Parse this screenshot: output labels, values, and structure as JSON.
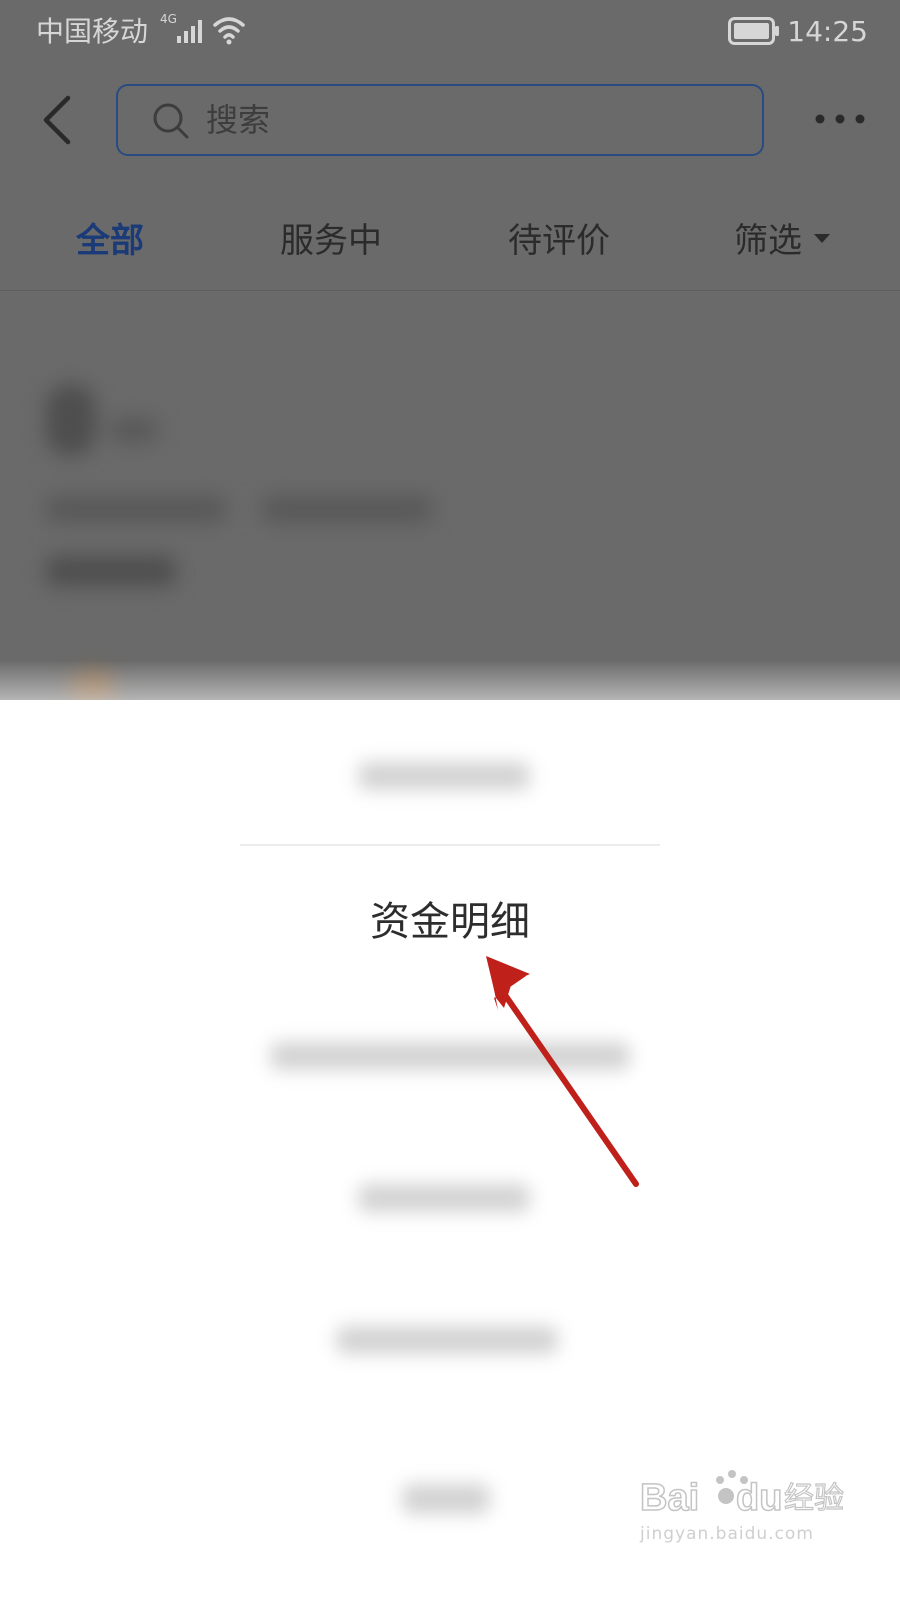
{
  "status_bar": {
    "carrier": "中国移动",
    "network_type": "4G",
    "time": "14:25",
    "icons": [
      "signal-icon",
      "wifi-icon",
      "battery-icon"
    ]
  },
  "header": {
    "back_icon": "chevron-left-icon",
    "search": {
      "placeholder": "搜索",
      "icon": "search-icon"
    },
    "more_icon": "more-horizontal-icon"
  },
  "tabs": [
    {
      "label": "全部",
      "active": true
    },
    {
      "label": "服务中",
      "active": false
    },
    {
      "label": "待评价",
      "active": false
    },
    {
      "label": "筛选",
      "active": false,
      "has_dropdown": true
    }
  ],
  "sheet": {
    "focused_option": "资金明细",
    "other_options_blurred": true
  },
  "annotation": {
    "arrow_color": "#c0201a",
    "arrow_target": "资金明细"
  },
  "watermark": {
    "logo_text": "Baidu经验",
    "url": "jingyan.baidu.com"
  },
  "colors": {
    "accent_blue": "#1a3a78",
    "overlay_gray": "#6a6a6a",
    "sheet_background": "#ffffff",
    "arrow_red": "#c0201a"
  }
}
